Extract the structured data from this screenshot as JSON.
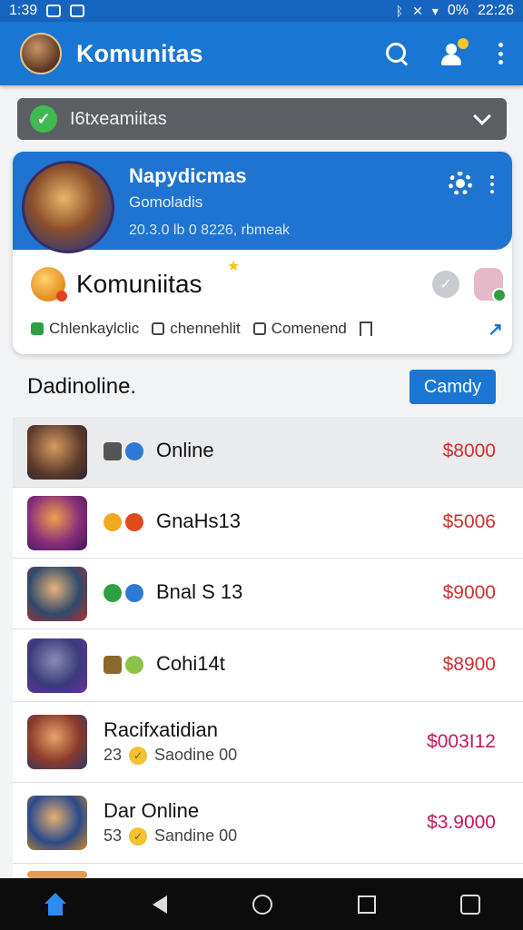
{
  "status_bar": {
    "time": "1:39",
    "battery": "0%",
    "clock": "22:26"
  },
  "app_bar": {
    "title": "Komunitas"
  },
  "selector": {
    "label": "I6txeamiitas"
  },
  "profile": {
    "name": "Napydicmas",
    "subtitle": "Gomoladis",
    "meta": "20.3.0 lb 0 8226, rbmeak"
  },
  "community": {
    "title": "Komuniitas",
    "chips": [
      "Chlenkaylclic",
      "chennehlit",
      "Comenend"
    ]
  },
  "online": {
    "title": "Dadinoline.",
    "button_label": "Camdy"
  },
  "list": [
    {
      "name": "Online",
      "price": "$8000"
    },
    {
      "name": "GnaHs13",
      "price": "$5006"
    },
    {
      "name": "Bnal S 13",
      "price": "$9000"
    },
    {
      "name": "Cohi14t",
      "price": "$8900"
    },
    {
      "name": "Racifxatidian",
      "sub_number": "23",
      "sub_text": "Saodine 00",
      "price": "$003I12"
    },
    {
      "name": "Dar Online",
      "sub_number": "53",
      "sub_text": "Sandine 00",
      "price": "$3.9000"
    }
  ],
  "colors": {
    "primary": "#1976d2",
    "price_red": "#d02f2f",
    "price_pink": "#c2185b"
  }
}
